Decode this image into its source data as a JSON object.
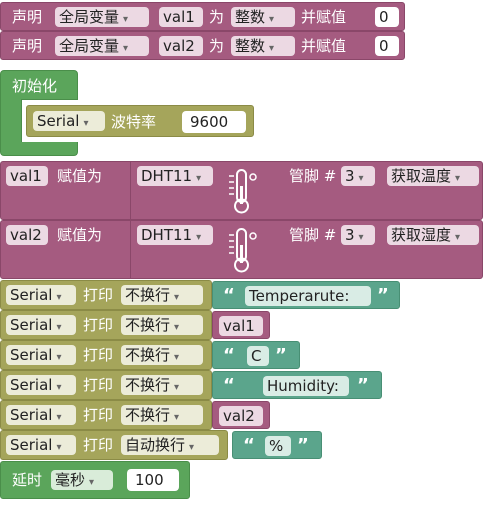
{
  "declare_rows": [
    {
      "keyword": "声明",
      "scope": "全局变量",
      "var": "val1",
      "as": "为",
      "type": "整数",
      "assign": "并赋值",
      "value": "0"
    },
    {
      "keyword": "声明",
      "scope": "全局变量",
      "var": "val2",
      "as": "为",
      "type": "整数",
      "assign": "并赋值",
      "value": "0"
    }
  ],
  "init": {
    "label": "初始化",
    "serial": "Serial",
    "baud_label": "波特率",
    "baud_value": "9600"
  },
  "dht_rows": [
    {
      "var": "val1",
      "assign": "赋值为",
      "sensor": "DHT11",
      "pin_label": "管脚 #",
      "pin": "3",
      "read": "获取温度"
    },
    {
      "var": "val2",
      "assign": "赋值为",
      "sensor": "DHT11",
      "pin_label": "管脚 #",
      "pin": "3",
      "read": "获取湿度"
    }
  ],
  "print_rows": [
    {
      "serial": "Serial",
      "print": "打印",
      "mode": "不换行",
      "kind": "text",
      "value": "Temperarute:"
    },
    {
      "serial": "Serial",
      "print": "打印",
      "mode": "不换行",
      "kind": "var",
      "value": "val1"
    },
    {
      "serial": "Serial",
      "print": "打印",
      "mode": "不换行",
      "kind": "text",
      "value": "C"
    },
    {
      "serial": "Serial",
      "print": "打印",
      "mode": "不换行",
      "kind": "text",
      "value": "Humidity:"
    },
    {
      "serial": "Serial",
      "print": "打印",
      "mode": "不换行",
      "kind": "var",
      "value": "val2"
    },
    {
      "serial": "Serial",
      "print": "打印",
      "mode": "自动换行",
      "kind": "text",
      "value": "%"
    }
  ],
  "delay": {
    "label": "延时",
    "unit": "毫秒",
    "value": "100"
  },
  "glyphs": {
    "dropdown_arrow": "▾",
    "open_quote": "“",
    "close_quote": "”"
  },
  "colors": {
    "variable": "#a55b80",
    "control": "#5ba55b",
    "serial": "#a5a55b",
    "text": "#5ba58c"
  }
}
